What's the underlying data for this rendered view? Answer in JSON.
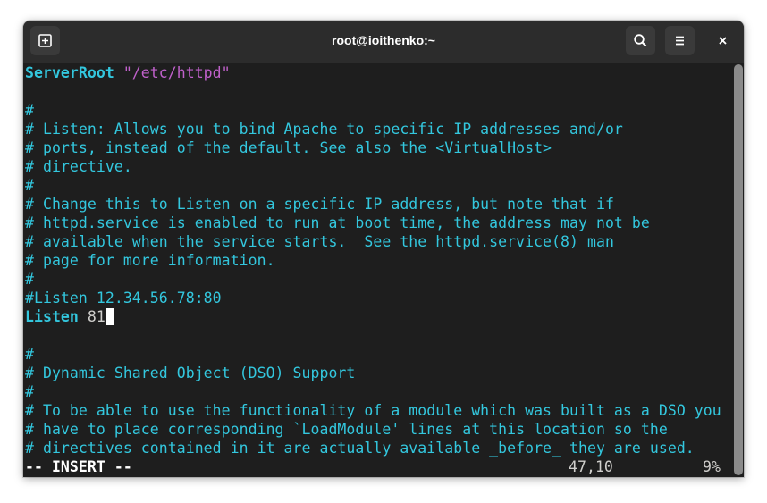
{
  "window": {
    "title": "root@ioithenko:~"
  },
  "header_buttons": {
    "new_tab_icon": "new-tab-icon",
    "search_icon": "search-icon",
    "menu_icon": "hamburger-menu-icon",
    "close_icon": "close-icon"
  },
  "editor": {
    "line_server_root_kw": "ServerRoot",
    "line_server_root_val": " \"/etc/httpd\"",
    "c1": "#",
    "c2": "# Listen: Allows you to bind Apache to specific IP addresses and/or",
    "c3": "# ports, instead of the default. See also the <VirtualHost>",
    "c4": "# directive.",
    "c5": "#",
    "c6": "# Change this to Listen on a specific IP address, but note that if",
    "c7": "# httpd.service is enabled to run at boot time, the address may not be",
    "c8": "# available when the service starts.  See the httpd.service(8) man",
    "c9": "# page for more information.",
    "c10": "#",
    "c11": "#Listen 12.34.56.78:80",
    "listen_kw": "Listen",
    "listen_val": " 81",
    "d1": "#",
    "d2": "# Dynamic Shared Object (DSO) Support",
    "d3": "#",
    "d4": "# To be able to use the functionality of a module which was built as a DSO you",
    "d5": "# have to place corresponding `LoadModule' lines at this location so the",
    "d6": "# directives contained in it are actually available _before_ they are used."
  },
  "status_line": {
    "mode": "-- INSERT --",
    "position": "47,10",
    "percent": "9%"
  },
  "colors": {
    "background": "#1e1e1e",
    "keyword": "#33c7de",
    "string": "#c061cb",
    "comment": "#33c7de"
  }
}
